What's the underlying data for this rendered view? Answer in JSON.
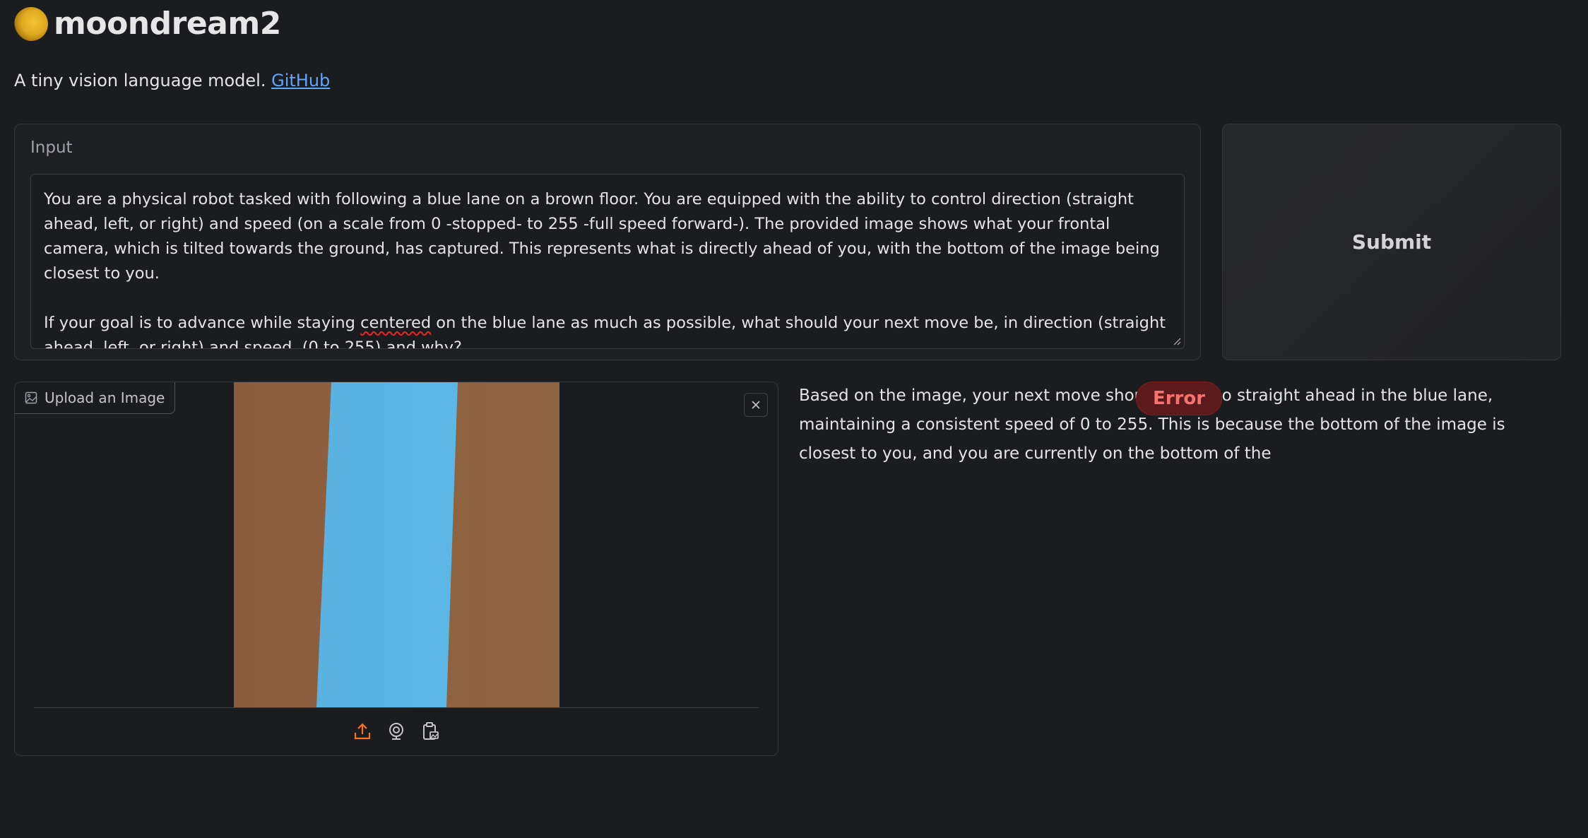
{
  "app": {
    "title": "moondream2",
    "subtitle_text": "A tiny vision language model. ",
    "github_link": "GitHub",
    "logo_icon": "moon-icon"
  },
  "input": {
    "label": "Input",
    "prompt_part1": "You are a physical robot tasked with following a blue lane on a brown floor. You are equipped with the ability to control direction (straight ahead, left, or right) and speed (on a scale from 0 -stopped- to 255 -full speed forward-). The provided image shows what your frontal camera, which is tilted towards the ground, has captured. This represents what is directly ahead of you, with the bottom of the image being closest to you.\n\nIf your goal is to advance while staying ",
    "prompt_spell_word": "centered",
    "prompt_part2": " on the blue lane as much as possible, what should your next move be, in direction (straight ahead, left, or right) and speed  (0 to 255) and why?"
  },
  "submit": {
    "label": "Submit"
  },
  "image_upload": {
    "label": "Upload an Image",
    "label_icon": "image-icon",
    "close_icon": "close-icon",
    "tools": [
      "upload-icon",
      "webcam-icon",
      "clipboard-icon"
    ],
    "colors": {
      "floor": "#8e5d3f",
      "lane": "#5ab4e3",
      "accent": "#f97316"
    }
  },
  "output": {
    "text": "Based on the image, your next move should be to go straight ahead in the blue lane, maintaining a consistent speed of 0 to 255. This is because the bottom of the image is closest to you, and you are currently on the bottom of the",
    "error_badge": "Error",
    "error_color": "#f87171"
  }
}
